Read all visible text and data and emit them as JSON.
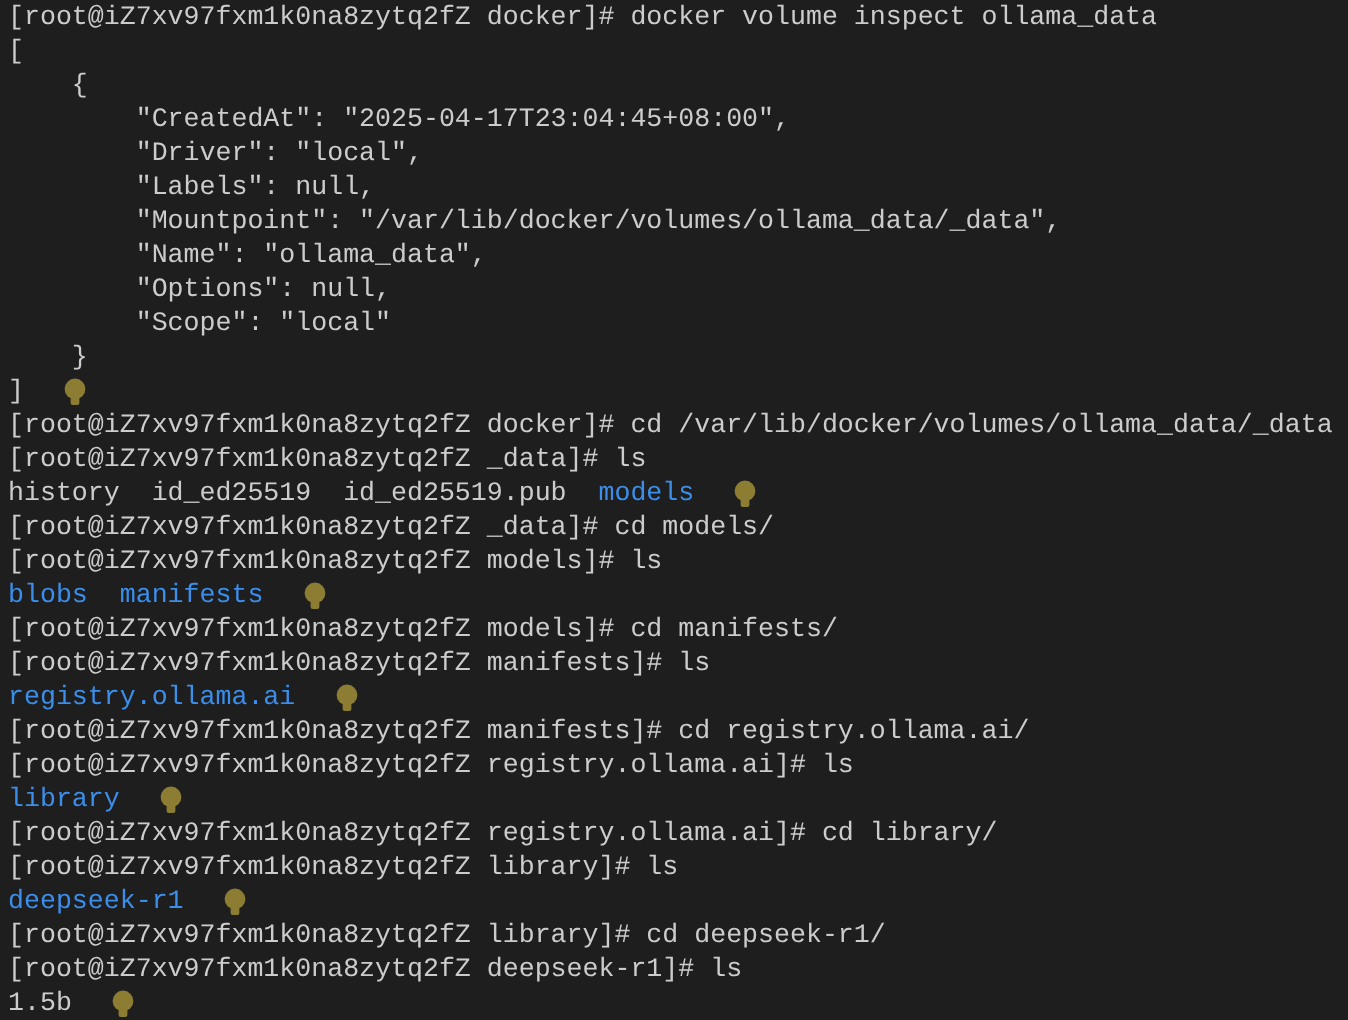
{
  "terminal": {
    "lines": [
      {
        "kind": "command",
        "text": "[root@iZ7xv97fxm1k0na8zytq2fZ docker]# docker volume inspect ollama_data"
      },
      {
        "kind": "output",
        "text": "["
      },
      {
        "kind": "output",
        "text": "    {"
      },
      {
        "kind": "output",
        "text": "        \"CreatedAt\": \"2025-04-17T23:04:45+08:00\","
      },
      {
        "kind": "output",
        "text": "        \"Driver\": \"local\","
      },
      {
        "kind": "output",
        "text": "        \"Labels\": null,"
      },
      {
        "kind": "output",
        "text": "        \"Mountpoint\": \"/var/lib/docker/volumes/ollama_data/_data\","
      },
      {
        "kind": "output",
        "text": "        \"Name\": \"ollama_data\","
      },
      {
        "kind": "output",
        "text": "        \"Options\": null,"
      },
      {
        "kind": "output",
        "text": "        \"Scope\": \"local\""
      },
      {
        "kind": "output",
        "text": "    }"
      },
      {
        "kind": "output",
        "text": "]",
        "hint_icon": true
      },
      {
        "kind": "command",
        "text": "[root@iZ7xv97fxm1k0na8zytq2fZ docker]# cd /var/lib/docker/volumes/ollama_data/_data"
      },
      {
        "kind": "command",
        "text": "[root@iZ7xv97fxm1k0na8zytq2fZ _data]# ls"
      },
      {
        "kind": "listing",
        "hint_icon": true,
        "entries": [
          {
            "name": "history",
            "kind": "file"
          },
          {
            "name": "id_ed25519",
            "kind": "file"
          },
          {
            "name": "id_ed25519.pub",
            "kind": "file"
          },
          {
            "name": "models",
            "kind": "dir"
          }
        ]
      },
      {
        "kind": "command",
        "text": "[root@iZ7xv97fxm1k0na8zytq2fZ _data]# cd models/"
      },
      {
        "kind": "command",
        "text": "[root@iZ7xv97fxm1k0na8zytq2fZ models]# ls"
      },
      {
        "kind": "listing",
        "hint_icon": true,
        "entries": [
          {
            "name": "blobs",
            "kind": "dir"
          },
          {
            "name": "manifests",
            "kind": "dir"
          }
        ]
      },
      {
        "kind": "command",
        "text": "[root@iZ7xv97fxm1k0na8zytq2fZ models]# cd manifests/"
      },
      {
        "kind": "command",
        "text": "[root@iZ7xv97fxm1k0na8zytq2fZ manifests]# ls"
      },
      {
        "kind": "listing",
        "hint_icon": true,
        "entries": [
          {
            "name": "registry.ollama.ai",
            "kind": "dir"
          }
        ]
      },
      {
        "kind": "command",
        "text": "[root@iZ7xv97fxm1k0na8zytq2fZ manifests]# cd registry.ollama.ai/"
      },
      {
        "kind": "command",
        "text": "[root@iZ7xv97fxm1k0na8zytq2fZ registry.ollama.ai]# ls"
      },
      {
        "kind": "listing",
        "hint_icon": true,
        "entries": [
          {
            "name": "library",
            "kind": "dir"
          }
        ]
      },
      {
        "kind": "command",
        "text": "[root@iZ7xv97fxm1k0na8zytq2fZ registry.ollama.ai]# cd library/"
      },
      {
        "kind": "command",
        "text": "[root@iZ7xv97fxm1k0na8zytq2fZ library]# ls"
      },
      {
        "kind": "listing",
        "hint_icon": true,
        "entries": [
          {
            "name": "deepseek-r1",
            "kind": "dir"
          }
        ]
      },
      {
        "kind": "command",
        "text": "[root@iZ7xv97fxm1k0na8zytq2fZ library]# cd deepseek-r1/"
      },
      {
        "kind": "command",
        "text": "[root@iZ7xv97fxm1k0na8zytq2fZ deepseek-r1]# ls"
      },
      {
        "kind": "listing",
        "hint_icon": true,
        "entries": [
          {
            "name": "1.5b",
            "kind": "file"
          }
        ]
      }
    ]
  }
}
